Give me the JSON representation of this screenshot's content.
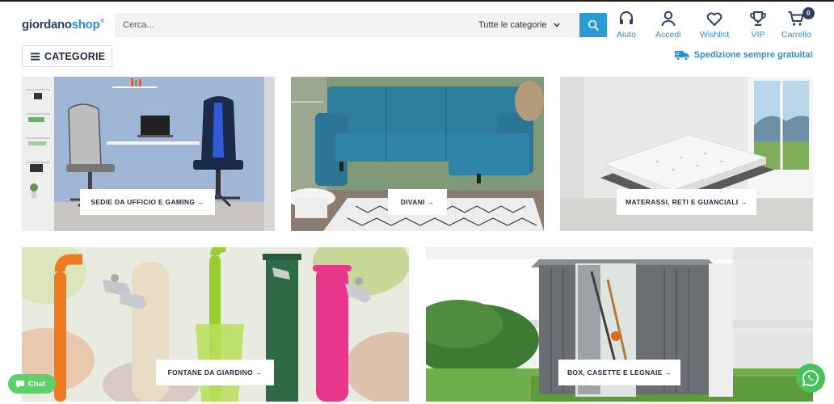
{
  "header": {
    "logo_part1": "giordano",
    "logo_part2": "shop",
    "logo_mark": "®",
    "search_placeholder": "Cerca...",
    "category_select": "Tutte le categorie",
    "nav": [
      {
        "label": "Aiuto",
        "icon": "headset-icon"
      },
      {
        "label": "Accedi",
        "icon": "user-icon"
      },
      {
        "label": "Wishlist",
        "icon": "heart-icon"
      },
      {
        "label": "VIP",
        "icon": "trophy-icon"
      },
      {
        "label": "Carrello",
        "icon": "cart-icon",
        "badge": "0"
      }
    ]
  },
  "subheader": {
    "categories_label": "CATEGORIE",
    "shipping_text": "Spedizione sempre gratuita!"
  },
  "tiles": [
    {
      "label": "SEDIE DA UFFICIO E GAMING →"
    },
    {
      "label": "DIVANI →"
    },
    {
      "label": "MATERASSI, RETI E GUANCIALI →"
    },
    {
      "label": "FONTANE DA GIARDINO →"
    },
    {
      "label": "BOX, CASETTE E LEGNAIE →"
    }
  ],
  "widgets": {
    "chat_label": "Chat"
  },
  "colors": {
    "accent": "#2b8ed6",
    "navy": "#2c3e66",
    "search_button": "#2b9bd6",
    "chat_green": "#5fd16a",
    "whatsapp_green": "#46c35a"
  }
}
